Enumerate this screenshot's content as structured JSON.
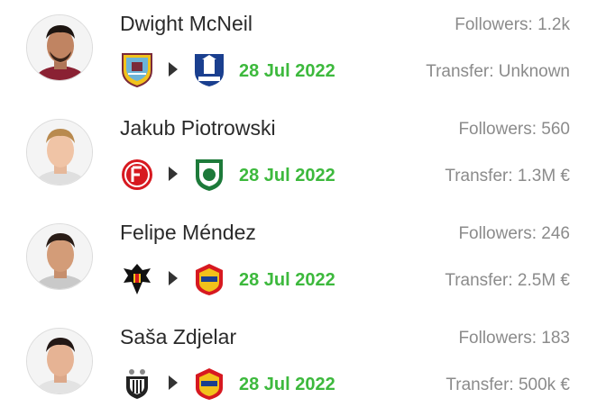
{
  "transfers": [
    {
      "name": "Dwight McNeil",
      "followers": "Followers: 1.2k",
      "transfer": "Transfer: Unknown",
      "date": "28 Jul 2022",
      "from_club_icon": "burnley-crest-icon",
      "to_club_icon": "everton-crest-icon"
    },
    {
      "name": "Jakub Piotrowski",
      "followers": "Followers: 560",
      "transfer": "Transfer: 1.3M €",
      "date": "28 Jul 2022",
      "from_club_icon": "fortuna-duesseldorf-crest-icon",
      "to_club_icon": "ludogorets-crest-icon"
    },
    {
      "name": "Felipe Méndez",
      "followers": "Followers: 246",
      "transfer": "Transfer: 2.5M €",
      "date": "28 Jul 2022",
      "from_club_icon": "eagle-crest-icon",
      "to_club_icon": "cska-moscow-crest-icon"
    },
    {
      "name": "Saša Zdjelar",
      "followers": "Followers: 183",
      "transfer": "Transfer: 500k €",
      "date": "28 Jul 2022",
      "from_club_icon": "partizan-crest-icon",
      "to_club_icon": "cska-moscow-crest-icon"
    }
  ],
  "colors": {
    "date_green": "#3db93d",
    "secondary_text": "#8b8b8b",
    "primary_text": "#2a2a2a"
  }
}
